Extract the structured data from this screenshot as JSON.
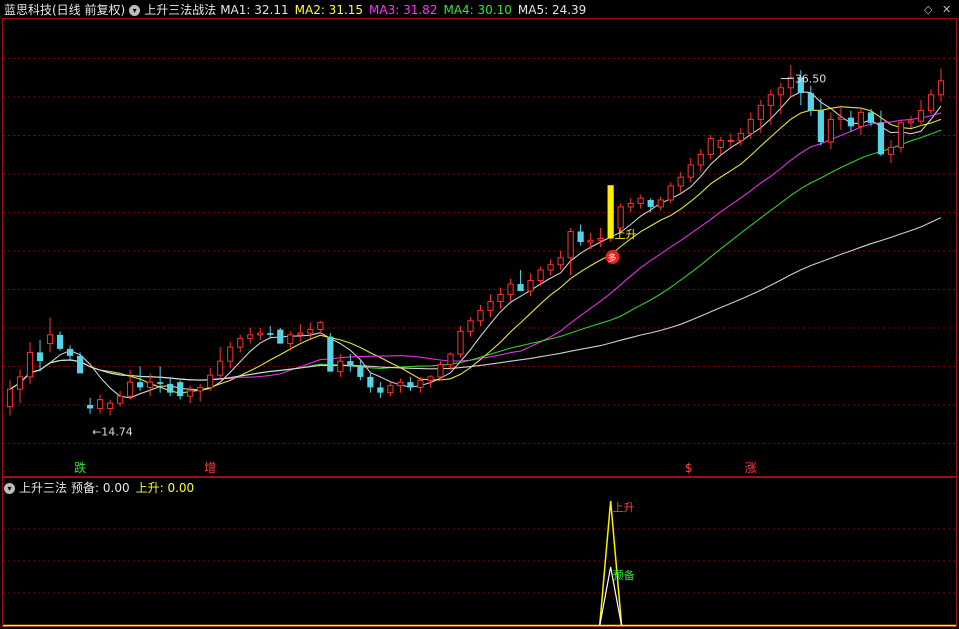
{
  "header": {
    "stock": "蓝思科技(日线 前复权)",
    "indicator": "上升三法战法",
    "ma": [
      {
        "label": "MA1:",
        "value": "32.11",
        "color": "#e6e6e6"
      },
      {
        "label": "MA2:",
        "value": "31.15",
        "color": "#ffff33"
      },
      {
        "label": "MA3:",
        "value": "31.82",
        "color": "#ff33ff"
      },
      {
        "label": "MA4:",
        "value": "30.10",
        "color": "#33e633"
      },
      {
        "label": "MA5:",
        "value": "24.39",
        "color": "#e6e6e6"
      }
    ],
    "icons": {
      "dropdown": "chevron-down-icon",
      "diamond": "diamond-icon",
      "close": "close-icon"
    }
  },
  "sub_header": {
    "name": "上升三法",
    "items": [
      {
        "label": "预备:",
        "value": "0.00",
        "color": "#e6e6e6"
      },
      {
        "label": "上升:",
        "value": "0.00",
        "color": "#ffff33"
      }
    ]
  },
  "annotations": {
    "high": "36.50",
    "low": "14.74",
    "rise_label": "上升",
    "buy_marker": "多",
    "ready_label": "预备",
    "rise_label2": "上升"
  },
  "bottom_marks": [
    {
      "text": "跌",
      "color": "#33e633",
      "bar": 7
    },
    {
      "text": "增",
      "color": "#ff4040",
      "bar": 20
    },
    {
      "text": "$",
      "color": "#ff4040",
      "bar": 68
    },
    {
      "text": "涨",
      "color": "#ff4040",
      "bar": 74
    }
  ],
  "colors": {
    "up": "#ff3232",
    "down": "#54d4e6",
    "grid": "#8b0000",
    "axis": "#9b1010"
  },
  "chart_data": {
    "type": "candlestick",
    "ylim": [
      13.5,
      38.5
    ],
    "high_marker_bar": 77,
    "low_marker_bar": 8,
    "signal_bar": 60,
    "candles": [
      [
        17.0,
        18.5,
        16.5,
        18.0
      ],
      [
        18.0,
        19.1,
        17.2,
        18.7
      ],
      [
        18.7,
        20.7,
        18.3,
        20.1
      ],
      [
        20.1,
        20.8,
        19.0,
        19.6
      ],
      [
        20.6,
        22.1,
        20.1,
        21.1
      ],
      [
        21.1,
        21.3,
        20.2,
        20.3
      ],
      [
        20.3,
        20.5,
        19.6,
        19.9
      ],
      [
        19.9,
        20.1,
        18.9,
        18.9
      ],
      [
        17.1,
        17.5,
        16.6,
        16.9
      ],
      [
        16.9,
        17.7,
        16.6,
        17.4
      ],
      [
        16.9,
        17.4,
        16.5,
        17.2
      ],
      [
        17.2,
        17.9,
        17.0,
        17.6
      ],
      [
        17.6,
        19.1,
        17.4,
        18.4
      ],
      [
        18.4,
        19.3,
        17.9,
        18.1
      ],
      [
        18.1,
        18.9,
        17.6,
        18.4
      ],
      [
        18.4,
        19.3,
        17.8,
        18.3
      ],
      [
        18.3,
        18.7,
        17.6,
        17.8
      ],
      [
        18.4,
        18.5,
        17.4,
        17.6
      ],
      [
        17.6,
        18.2,
        17.2,
        17.9
      ],
      [
        17.9,
        18.3,
        17.3,
        18.1
      ],
      [
        18.1,
        19.2,
        17.9,
        18.8
      ],
      [
        18.8,
        20.4,
        18.6,
        19.6
      ],
      [
        19.6,
        20.7,
        19.2,
        20.4
      ],
      [
        20.4,
        21.1,
        20.1,
        20.9
      ],
      [
        20.9,
        21.5,
        20.6,
        21.1
      ],
      [
        21.1,
        21.5,
        20.8,
        21.2
      ],
      [
        21.2,
        21.6,
        20.9,
        21.1
      ],
      [
        21.4,
        21.5,
        20.6,
        20.6
      ],
      [
        20.6,
        21.3,
        20.2,
        21.1
      ],
      [
        21.1,
        21.7,
        20.7,
        21.2
      ],
      [
        21.2,
        21.8,
        20.9,
        21.4
      ],
      [
        21.4,
        21.9,
        21.2,
        21.8
      ],
      [
        21.0,
        21.2,
        19.0,
        19.0
      ],
      [
        19.0,
        20.0,
        18.7,
        19.6
      ],
      [
        19.6,
        20.0,
        19.0,
        19.3
      ],
      [
        19.3,
        19.7,
        18.5,
        18.7
      ],
      [
        18.7,
        18.9,
        17.8,
        18.1
      ],
      [
        18.1,
        18.4,
        17.5,
        17.8
      ],
      [
        17.8,
        18.4,
        17.6,
        18.2
      ],
      [
        18.2,
        18.6,
        17.8,
        18.4
      ],
      [
        18.4,
        18.7,
        17.9,
        18.1
      ],
      [
        18.1,
        18.7,
        17.8,
        18.5
      ],
      [
        18.5,
        18.8,
        18.1,
        18.7
      ],
      [
        18.7,
        19.6,
        18.5,
        19.4
      ],
      [
        19.4,
        20.1,
        19.1,
        20.0
      ],
      [
        20.0,
        21.6,
        19.8,
        21.3
      ],
      [
        21.3,
        22.1,
        21.0,
        21.9
      ],
      [
        21.9,
        22.8,
        21.6,
        22.5
      ],
      [
        22.5,
        23.4,
        22.1,
        23.0
      ],
      [
        23.0,
        23.8,
        22.6,
        23.4
      ],
      [
        23.4,
        24.3,
        23.0,
        24.0
      ],
      [
        24.0,
        24.8,
        23.6,
        23.6
      ],
      [
        23.6,
        24.6,
        23.3,
        24.2
      ],
      [
        24.2,
        25.0,
        23.9,
        24.8
      ],
      [
        24.8,
        25.4,
        24.5,
        25.1
      ],
      [
        25.1,
        25.9,
        24.8,
        25.5
      ],
      [
        25.5,
        27.2,
        24.5,
        27.0
      ],
      [
        27.0,
        27.4,
        26.2,
        26.4
      ],
      [
        26.4,
        26.9,
        26.0,
        26.5
      ],
      [
        26.5,
        27.2,
        26.1,
        26.6
      ],
      [
        26.6,
        27.2,
        26.4,
        26.9
      ],
      [
        27.2,
        28.6,
        27.0,
        28.4
      ],
      [
        28.4,
        28.9,
        28.1,
        28.6
      ],
      [
        28.6,
        29.1,
        28.3,
        28.9
      ],
      [
        28.8,
        28.9,
        28.1,
        28.4
      ],
      [
        28.4,
        29.0,
        28.2,
        28.8
      ],
      [
        28.8,
        29.8,
        28.6,
        29.6
      ],
      [
        29.6,
        30.4,
        29.2,
        30.1
      ],
      [
        30.1,
        31.2,
        29.8,
        30.8
      ],
      [
        30.8,
        31.7,
        30.4,
        31.4
      ],
      [
        31.4,
        32.5,
        31.1,
        32.3
      ],
      [
        31.8,
        32.4,
        31.4,
        32.2
      ],
      [
        32.2,
        32.6,
        31.7,
        32.2
      ],
      [
        32.2,
        32.9,
        31.9,
        32.6
      ],
      [
        32.6,
        33.8,
        32.3,
        33.4
      ],
      [
        33.4,
        34.5,
        32.6,
        34.2
      ],
      [
        34.2,
        35.1,
        33.1,
        34.8
      ],
      [
        34.8,
        35.5,
        33.7,
        35.2
      ],
      [
        35.2,
        36.5,
        34.7,
        35.8
      ],
      [
        35.8,
        36.2,
        34.2,
        34.9
      ],
      [
        34.9,
        35.3,
        33.6,
        33.9
      ],
      [
        33.9,
        34.6,
        31.9,
        32.1
      ],
      [
        32.1,
        33.8,
        31.7,
        33.4
      ],
      [
        33.4,
        34.2,
        32.8,
        33.5
      ],
      [
        33.5,
        33.9,
        32.7,
        33.0
      ],
      [
        33.0,
        34.1,
        32.5,
        33.8
      ],
      [
        33.8,
        34.0,
        33.0,
        33.2
      ],
      [
        33.2,
        33.9,
        31.3,
        31.4
      ],
      [
        31.4,
        32.2,
        30.9,
        31.8
      ],
      [
        31.8,
        33.4,
        31.5,
        33.2
      ],
      [
        33.2,
        33.6,
        32.9,
        33.3
      ],
      [
        33.3,
        34.5,
        33.0,
        33.9
      ],
      [
        33.9,
        35.1,
        33.7,
        34.8
      ],
      [
        34.8,
        36.3,
        34.4,
        35.6
      ]
    ]
  }
}
